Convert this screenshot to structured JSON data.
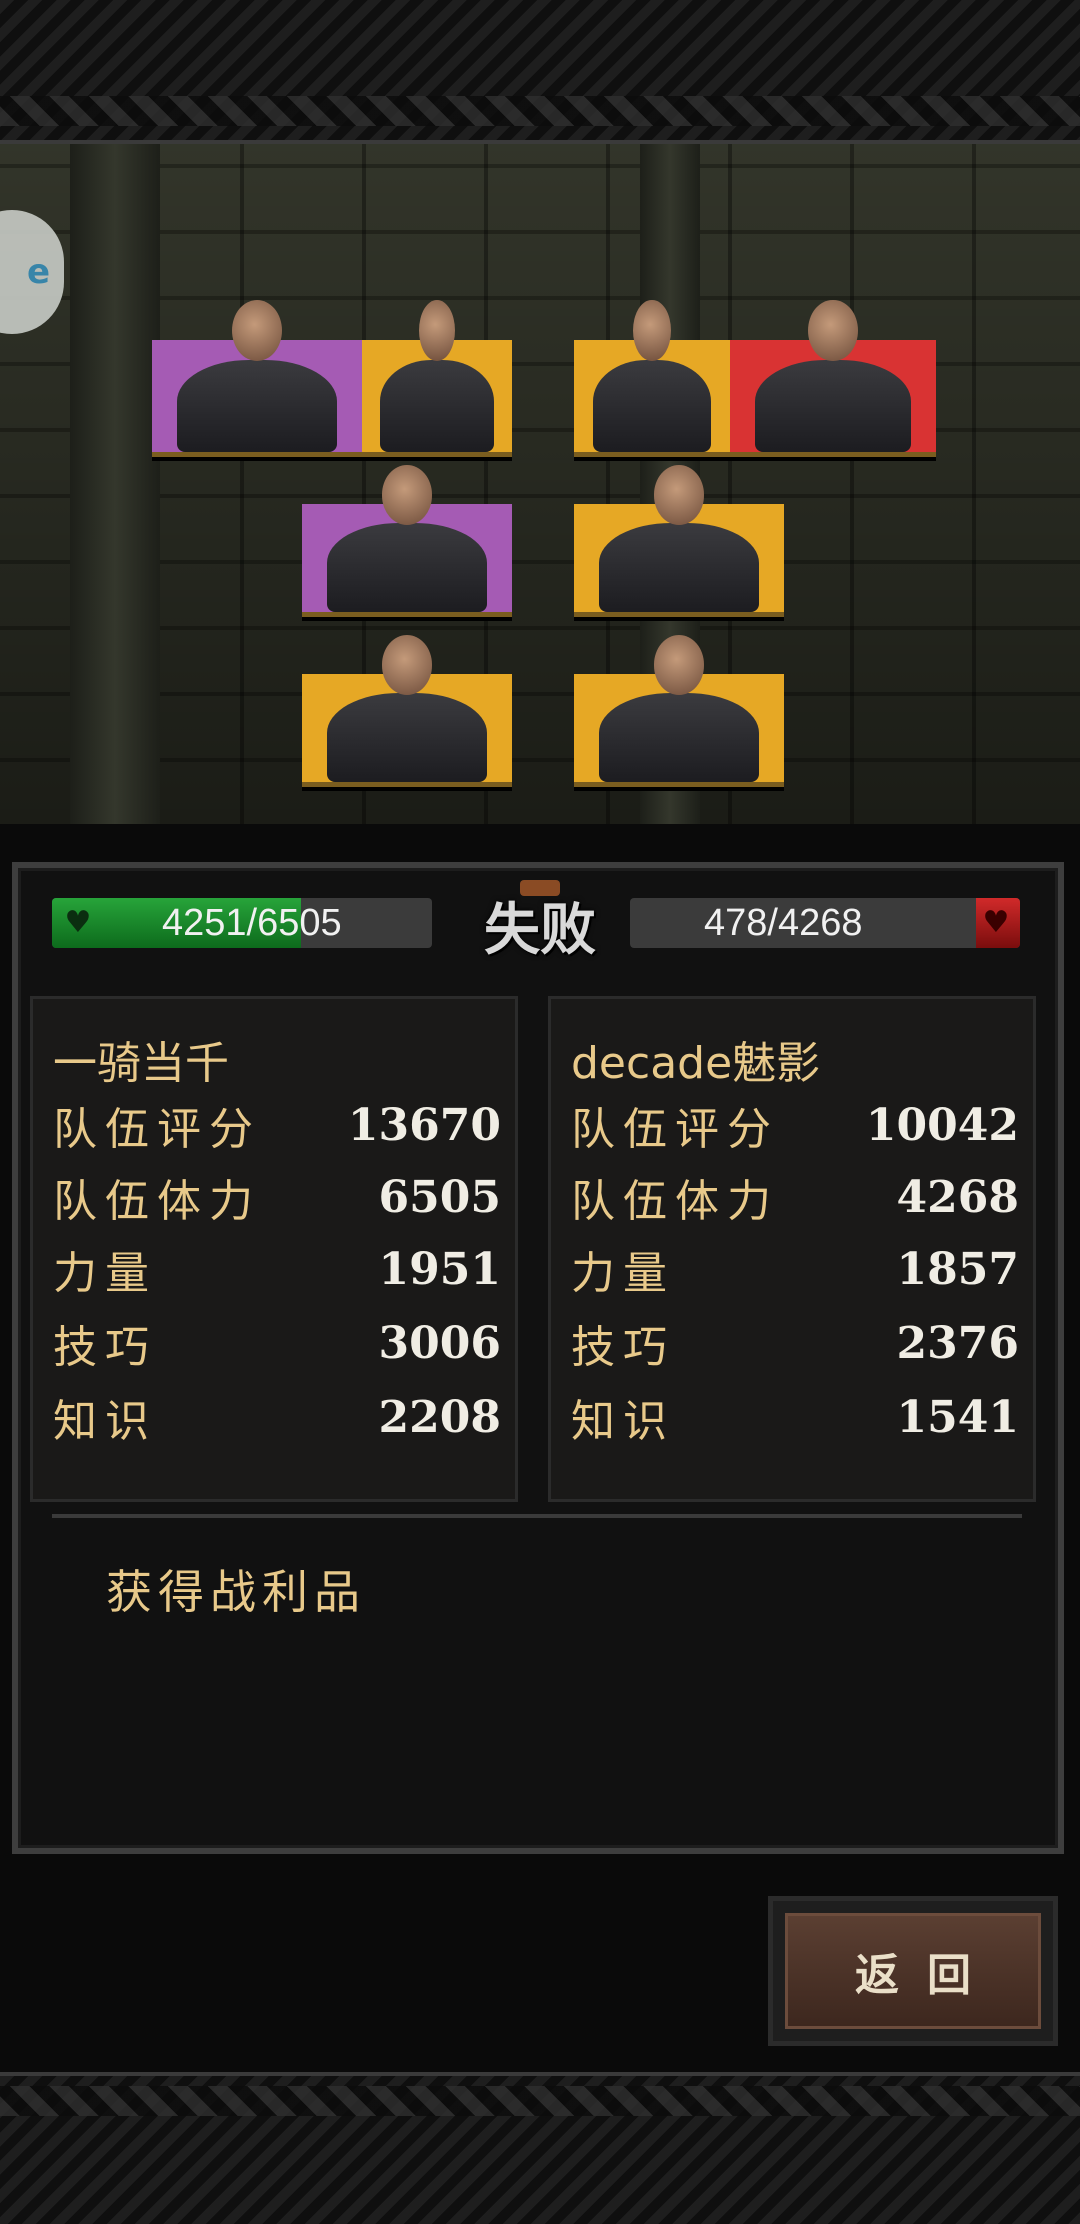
{
  "battle": {
    "result": "失败",
    "left_hp": "4251/6505",
    "right_hp": "478/4268",
    "left_hp_fraction": 0.654,
    "right_hp_fraction": 0.112
  },
  "side_bubble_text": "e",
  "teams": {
    "left": {
      "name": "一骑当千",
      "stats": [
        {
          "label": "队伍评分",
          "value": "13670"
        },
        {
          "label": "队伍体力",
          "value": "6505"
        },
        {
          "label": "力量",
          "value": "1951"
        },
        {
          "label": "技巧",
          "value": "3006"
        },
        {
          "label": "知识",
          "value": "2208"
        }
      ]
    },
    "right": {
      "name": "decade魅影",
      "stats": [
        {
          "label": "队伍评分",
          "value": "10042"
        },
        {
          "label": "队伍体力",
          "value": "4268"
        },
        {
          "label": "力量",
          "value": "1857"
        },
        {
          "label": "技巧",
          "value": "2376"
        },
        {
          "label": "知识",
          "value": "1541"
        }
      ]
    }
  },
  "loot_label": "获得战利品",
  "back_button_label": "返回",
  "colors": {
    "accent_text": "#e8c98a",
    "hp_green": "#27a43a",
    "hp_red": "#d12a2a",
    "card_purple": "#a55bb4",
    "card_orange": "#e6a825",
    "card_red": "#d93333"
  }
}
